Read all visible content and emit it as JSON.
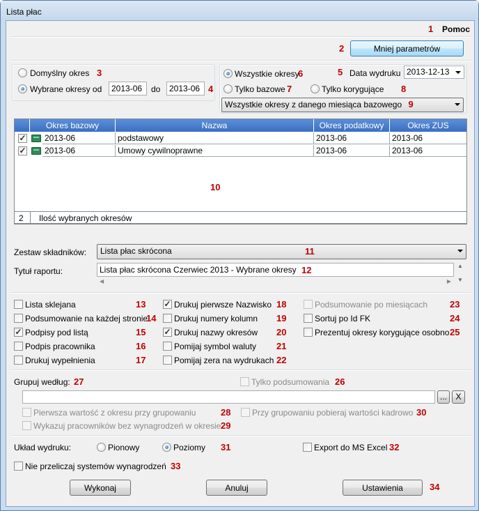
{
  "window": {
    "title": "Lista płac"
  },
  "menu": {
    "help_label": "Pomoc",
    "n1": "1"
  },
  "params_button": {
    "label": "Mniej parametrów",
    "n": "2"
  },
  "period": {
    "default_label": "Domyślny  okres",
    "n3": "3",
    "selected_label": "Wybrane okresy od",
    "from": "2013-06",
    "to_label": "do",
    "to": "2013-06",
    "n4": "4"
  },
  "scope": {
    "all_label": "Wszystkie okresy",
    "n6": "6",
    "n5": "5",
    "print_date_label": "Data wydruku",
    "print_date": "2013-12-13",
    "base_only_label": "Tylko bazowe",
    "n7": "7",
    "corr_only_label": "Tylko korygujące",
    "n8": "8",
    "combo_value": "Wszystkie okresy z danego miesiąca bazowego",
    "n9": "9"
  },
  "grid": {
    "headers": [
      "Okres bazowy",
      "Nazwa",
      "Okres podatkowy",
      "Okres ZUS"
    ],
    "rows": [
      {
        "checked": true,
        "base": "2013-06",
        "name": "podstawowy",
        "tax": "2013-06",
        "zus": "2013-06"
      },
      {
        "checked": true,
        "base": "2013-06",
        "name": "Umowy cywilnoprawne",
        "tax": "2013-06",
        "zus": "2013-06"
      }
    ],
    "n10": "10",
    "count": "2",
    "count_label": "Ilość wybranych okresów"
  },
  "components": {
    "label": "Zestaw składników:",
    "value": "Lista płac skrócona",
    "n11": "11"
  },
  "report_title": {
    "label": "Tytuł raportu:",
    "value": "Lista płac skrócona Czerwiec 2013 - Wybrane okresy",
    "n12": "12"
  },
  "options": {
    "col1": [
      {
        "label": "Lista sklejana",
        "n": "13",
        "checked": false
      },
      {
        "label": "Podsumowanie na każdej stronie",
        "n": "14",
        "checked": false
      },
      {
        "label": "Podpisy pod listą",
        "n": "15",
        "checked": true
      },
      {
        "label": "Podpis pracownika",
        "n": "16",
        "checked": false
      },
      {
        "label": "Drukuj wypełnienia",
        "n": "17",
        "checked": false
      }
    ],
    "col2": [
      {
        "label": "Drukuj pierwsze Nazwisko",
        "n": "18",
        "checked": true
      },
      {
        "label": "Drukuj numery kolumn",
        "n": "19",
        "checked": false
      },
      {
        "label": "Drukuj nazwy okresów",
        "n": "20",
        "checked": true
      },
      {
        "label": "Pomijaj symbol waluty",
        "n": "21",
        "checked": false
      },
      {
        "label": "Pomijaj zera na wydrukach",
        "n": "22",
        "checked": false
      }
    ],
    "col3": [
      {
        "label": "Podsumowanie po miesiącach",
        "n": "23",
        "checked": false,
        "disabled": true
      },
      {
        "label": "Sortuj po Id FK",
        "n": "24",
        "checked": false
      },
      {
        "label": "Prezentuj okresy korygujące osobno",
        "n": "25",
        "checked": false
      }
    ]
  },
  "grouping": {
    "label": "Grupuj według:",
    "n27": "27",
    "summary_only": "Tylko podsumowania",
    "n26": "26",
    "value": "",
    "browse": "...",
    "clear": "X",
    "first_value": "Pierwsza wartość z okresu przy grupowaniu",
    "n28": "28",
    "hr_values": "Przy grupowaniu pobieraj wartości kadrowo",
    "n30": "30",
    "no_salary": "Wykazuj pracowników bez wynagrodzeń w okresie",
    "n29": "29"
  },
  "layout": {
    "label": "Układ wydruku:",
    "portrait": "Pionowy",
    "landscape": "Poziomy",
    "n31": "31",
    "excel": "Export do MS Excel",
    "n32": "32"
  },
  "recalc": {
    "label": "Nie przeliczaj systemów wynagrodzeń",
    "n33": "33"
  },
  "footer": {
    "run": "Wykonaj",
    "cancel": "Anuluj",
    "settings": "Ustawienia",
    "n34": "34"
  }
}
